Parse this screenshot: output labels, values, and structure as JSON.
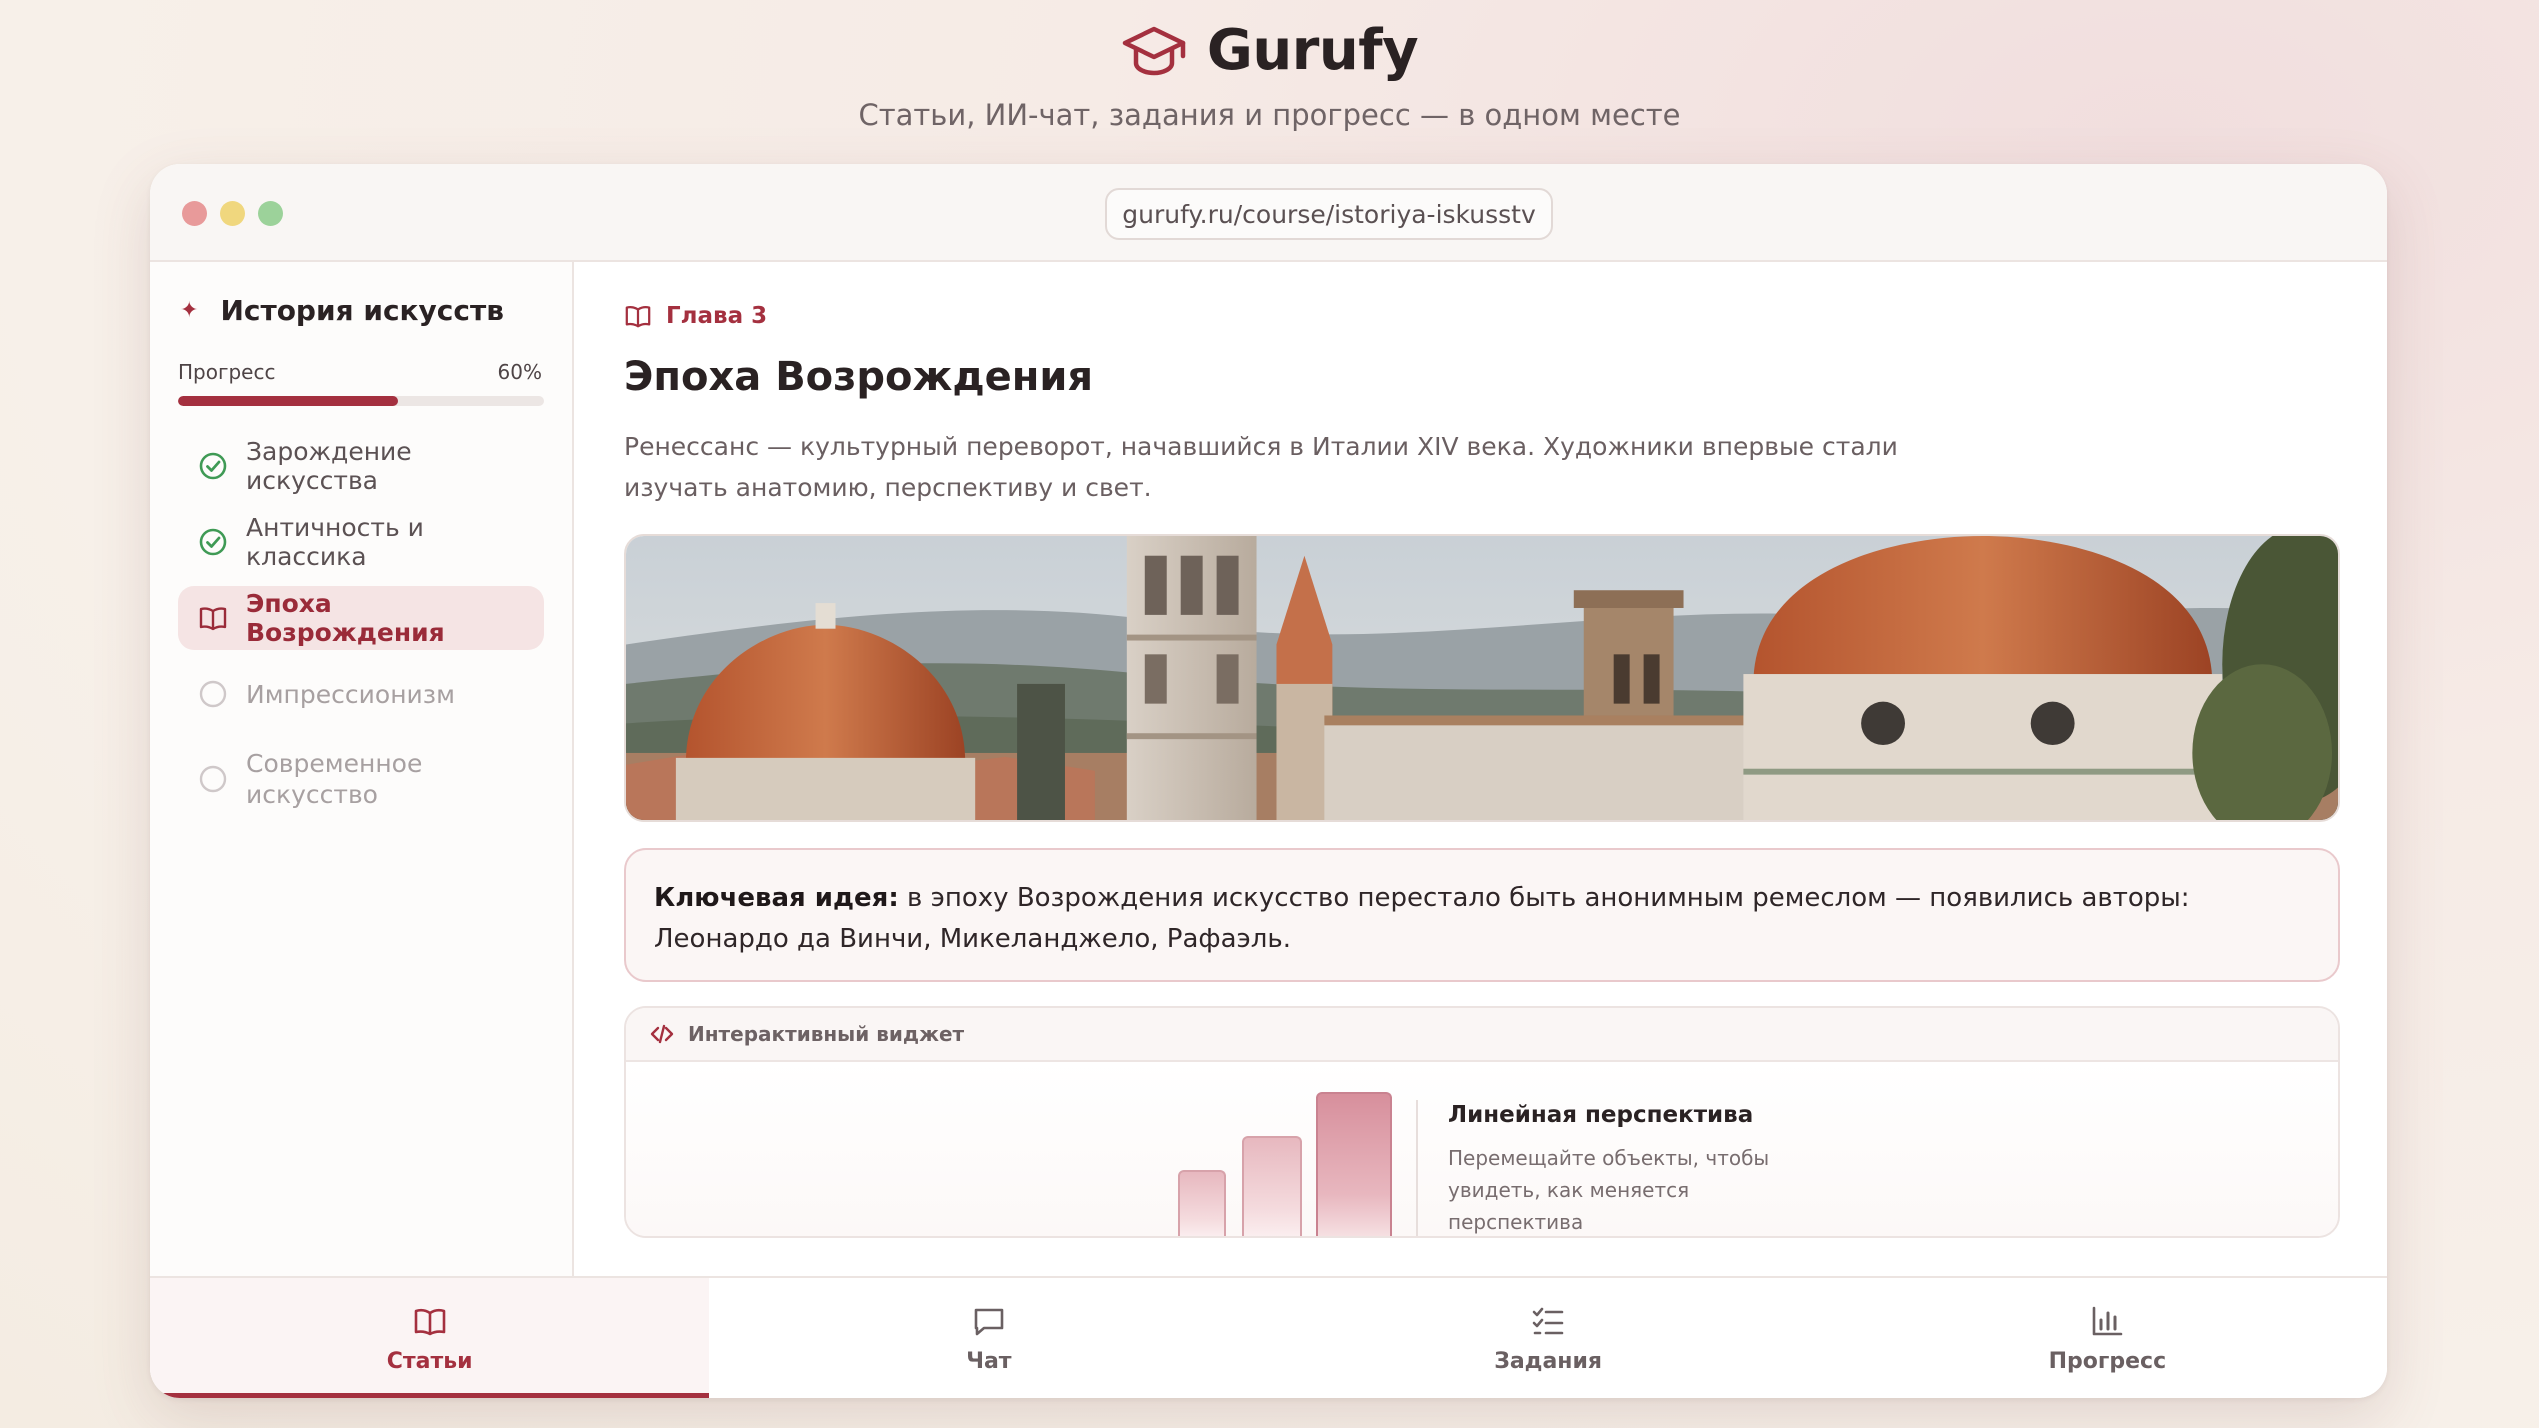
{
  "brand": {
    "name": "Gurufy",
    "tagline": "Статьи, ИИ-чат, задания и прогресс — в одном месте",
    "logo_icon": "graduation-cap-icon",
    "accent_color": "#a4303f"
  },
  "browser": {
    "url": "gurufy.ru/course/istoriya-iskusstv"
  },
  "sidebar": {
    "course_title": "История искусств",
    "progress_label": "Прогресс",
    "progress_text": "60%",
    "progress_value": 0.6,
    "lessons": [
      {
        "label": "Зарождение искусства",
        "status": "done",
        "icon": "check-circle-icon"
      },
      {
        "label": "Античность и классика",
        "status": "done",
        "icon": "check-circle-icon"
      },
      {
        "label": "Эпоха Возрождения",
        "status": "active",
        "icon": "book-icon"
      },
      {
        "label": "Импрессионизм",
        "status": "todo",
        "icon": "empty-circle-icon"
      },
      {
        "label": "Современное искусство",
        "status": "todo",
        "icon": "empty-circle-icon"
      }
    ]
  },
  "article": {
    "chapter": "Глава 3",
    "title": "Эпоха Возрождения",
    "intro": "Ренессанс — культурный переворот, начавшийся в Италии XIV века. Художники впервые стали изучать анатомию, перспективу и свет.",
    "key_idea_label": "Ключевая идея:",
    "key_idea_text": " в эпоху Возрождения искусство перестало быть анонимным ремеслом — появились авторы: Леонардо да Винчи, Микеланджело, Рафаэль."
  },
  "widget": {
    "label": "Интерактивный виджет",
    "title": "Линейная перспектива",
    "description": "Перемещайте объекты, чтобы увидеть, как меняется перспектива"
  },
  "tabs": [
    {
      "label": "Статьи",
      "icon": "book-icon",
      "active": true
    },
    {
      "label": "Чат",
      "icon": "chat-bubble-icon",
      "active": false
    },
    {
      "label": "Задания",
      "icon": "checklist-icon",
      "active": false
    },
    {
      "label": "Прогресс",
      "icon": "bar-chart-icon",
      "active": false
    }
  ]
}
